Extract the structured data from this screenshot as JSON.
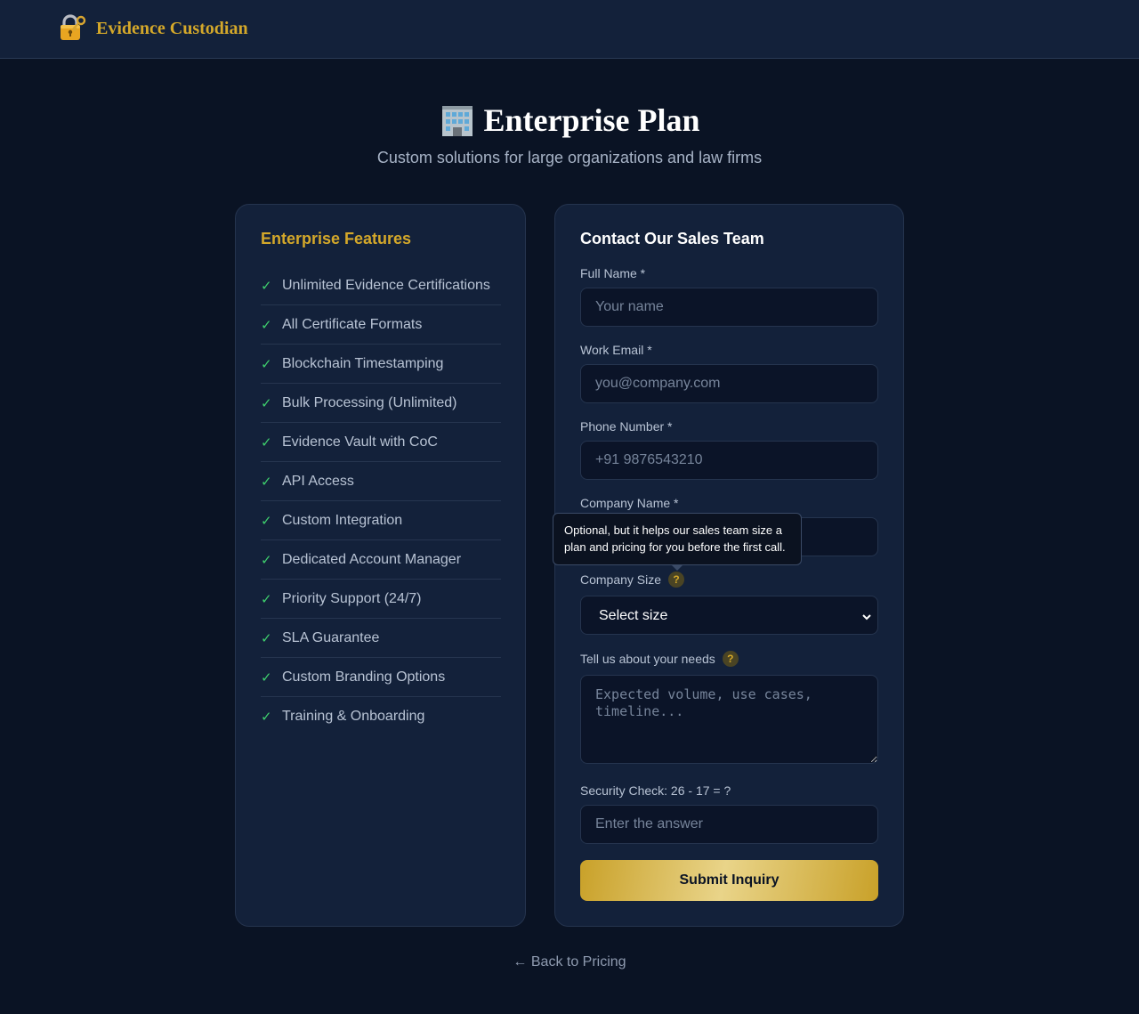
{
  "header": {
    "brand_name": "Evidence Custodian",
    "brand_icon": "lock-with-key-icon",
    "brand_color": "#d4a82a"
  },
  "hero": {
    "icon": "office-building-icon",
    "title": "Enterprise Plan",
    "subtitle": "Custom solutions for large organizations and law firms"
  },
  "features": {
    "heading": "Enterprise Features",
    "check_glyph": "✓",
    "items": [
      "Unlimited Evidence Certifications",
      "All Certificate Formats",
      "Blockchain Timestamping",
      "Bulk Processing (Unlimited)",
      "Evidence Vault with CoC",
      "API Access",
      "Custom Integration",
      "Dedicated Account Manager",
      "Priority Support (24/7)",
      "SLA Guarantee",
      "Custom Branding Options",
      "Training & Onboarding"
    ]
  },
  "contact": {
    "heading": "Contact Our Sales Team",
    "full_name": {
      "label": "Full Name *",
      "placeholder": "Your name",
      "value": ""
    },
    "work_email": {
      "label": "Work Email *",
      "placeholder": "you@company.com",
      "value": ""
    },
    "phone": {
      "label": "Phone Number *",
      "placeholder": "+91 9876543210",
      "value": ""
    },
    "company_name": {
      "label": "Company Name *",
      "placeholder": "",
      "value": ""
    },
    "company_size": {
      "label": "Company Size",
      "selected": "Select size",
      "help": "?"
    },
    "needs": {
      "label": "Tell us about your needs",
      "placeholder": "Expected volume, use cases, timeline...",
      "help": "?"
    },
    "security": {
      "label": "Security Check: 26 - 17 = ?",
      "placeholder": "Enter the answer",
      "value": ""
    },
    "submit_label": "Submit Inquiry"
  },
  "tooltip": {
    "text": "Optional, but it helps our sales team size a plan and pricing for you before the first call."
  },
  "footer": {
    "back_link": "← Back to Pricing"
  }
}
